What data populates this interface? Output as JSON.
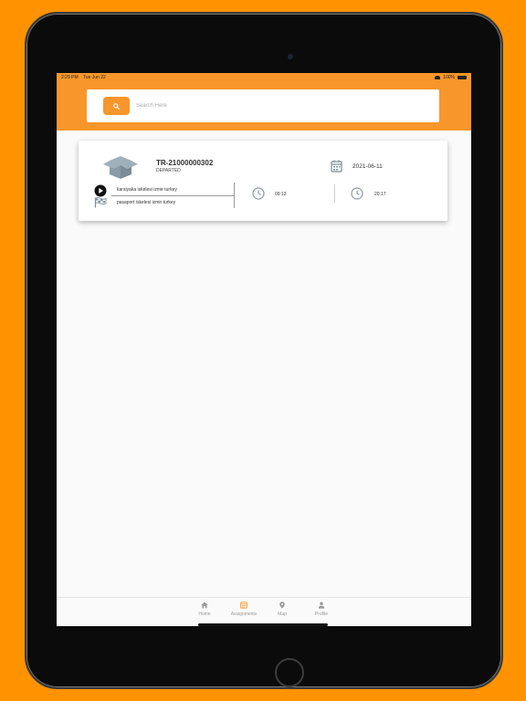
{
  "status_bar": {
    "time": "2:29 PM",
    "date": "Tue Jun 22",
    "battery": "100%"
  },
  "search": {
    "placeholder": "Search Here"
  },
  "assignment": {
    "order_id": "TR-21000000302",
    "status": "DEPARTED",
    "date": "2021-06-11",
    "origin": "karsiyaka iskelesi izmir turkey",
    "destination": "pasaport iskelesi izmir turkey",
    "departure_time": "09:13",
    "arrival_time": "20:17"
  },
  "nav": {
    "items": [
      {
        "label": "Home",
        "icon": "home-icon"
      },
      {
        "label": "Assignments",
        "icon": "assignments-icon"
      },
      {
        "label": "Map",
        "icon": "map-pin-icon"
      },
      {
        "label": "Profile",
        "icon": "person-icon"
      }
    ],
    "active_index": 1
  },
  "colors": {
    "accent": "#f7962a",
    "background": "#ff9200",
    "icon_gray": "#8a9aa6"
  }
}
